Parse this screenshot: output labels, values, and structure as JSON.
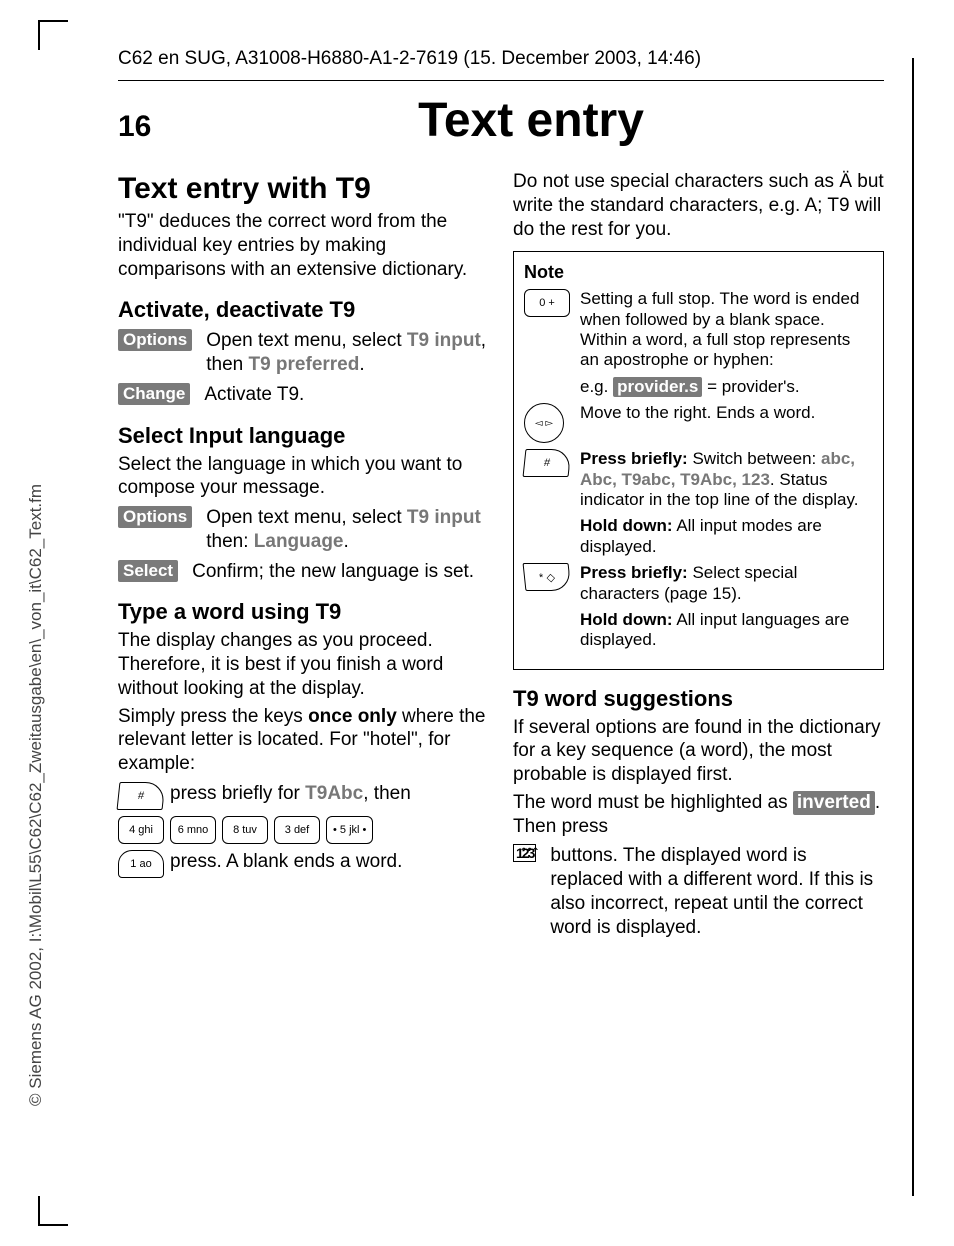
{
  "meta": {
    "running_head": "C62 en SUG, A31008-H6880-A1-2-7619 (15. December 2003, 14:46)",
    "page_number": "16",
    "chapter_title": "Text entry",
    "copyright": "© Siemens AG 2002, I:\\Mobil\\L55\\C62\\C62_Zweitausgabe\\en\\_von_it\\C62_Text.fm"
  },
  "left": {
    "h1": "Text entry with T9",
    "intro": "\"T9\" deduces the correct word from the individual key entries by making comparisons with an extensive dictionary.",
    "activate": {
      "heading": "Activate, deactivate T9",
      "options_label": "Options",
      "options_text_a": "Open text menu, select ",
      "options_text_b": "T9 input",
      "options_text_c": ", then ",
      "options_text_d": "T9 preferred",
      "options_text_e": ".",
      "change_label": "Change",
      "change_text": "Activate T9."
    },
    "lang": {
      "heading": "Select Input language",
      "intro": "Select the language in which you want to compose your message.",
      "options_label": "Options",
      "options_text_a": "Open text menu, select ",
      "options_text_b": "T9 input",
      "options_text_c": " then: ",
      "options_text_d": "Language",
      "options_text_e": ".",
      "select_label": "Select",
      "select_text": "Confirm; the new language is set."
    },
    "type": {
      "heading": "Type a word using T9",
      "p1": "The display changes as you proceed. Therefore, it is best if you finish a word without looking at the display.",
      "p2a": "Simply press the keys ",
      "p2b": "once only",
      "p2c": " where the relevant letter is located. For \"hotel\", for example:",
      "hash_text_a": "press briefly for ",
      "hash_text_b": "T9Abc",
      "hash_text_c": ", then",
      "keys": [
        "4 ghi",
        "6 mno",
        "8 tuv",
        "3 def",
        "• 5 jkl •"
      ],
      "one_key": "1 ao",
      "one_text": "press. A blank ends a word."
    }
  },
  "right": {
    "intro": "Do not use special characters such as Ä but write the standard characters, e.g. A; T9 will do the rest for you.",
    "note": {
      "title": "Note",
      "zero_key": "0 +",
      "zero_text": "Setting a full stop. The word is ended when followed by a blank space. Within a word, a full stop represents an apostrophe or hyphen:",
      "eg_a": "e.g. ",
      "eg_b": "provider.s",
      "eg_c": " = provider's.",
      "nav_text": "Move to the right. Ends a word.",
      "hash_a": "Press briefly:",
      "hash_b": " Switch between: ",
      "hash_modes": "abc, Abc, T9abc, T9Abc, 123",
      "hash_c": ". Status indicator in the top line of the display.",
      "hash_hold_a": "Hold down:",
      "hash_hold_b": " All input modes are displayed.",
      "star_a": "Press briefly:",
      "star_b": " Select special characters (page 15).",
      "star_hold_a": "Hold down:",
      "star_hold_b": " All input languages are displayed."
    },
    "sugg": {
      "heading": "T9 word suggestions",
      "p1": "If several options are found in the dictionary for a key sequence (a word), the most probable is displayed first.",
      "p2a": "The word must be highlighted as ",
      "p2b": "inverted",
      "p2c": ". Then press",
      "icon": "1̂2̂3̂",
      "btn_text": "buttons. The displayed word is replaced with a different word. If this is also incorrect, repeat until the correct word is displayed."
    }
  }
}
